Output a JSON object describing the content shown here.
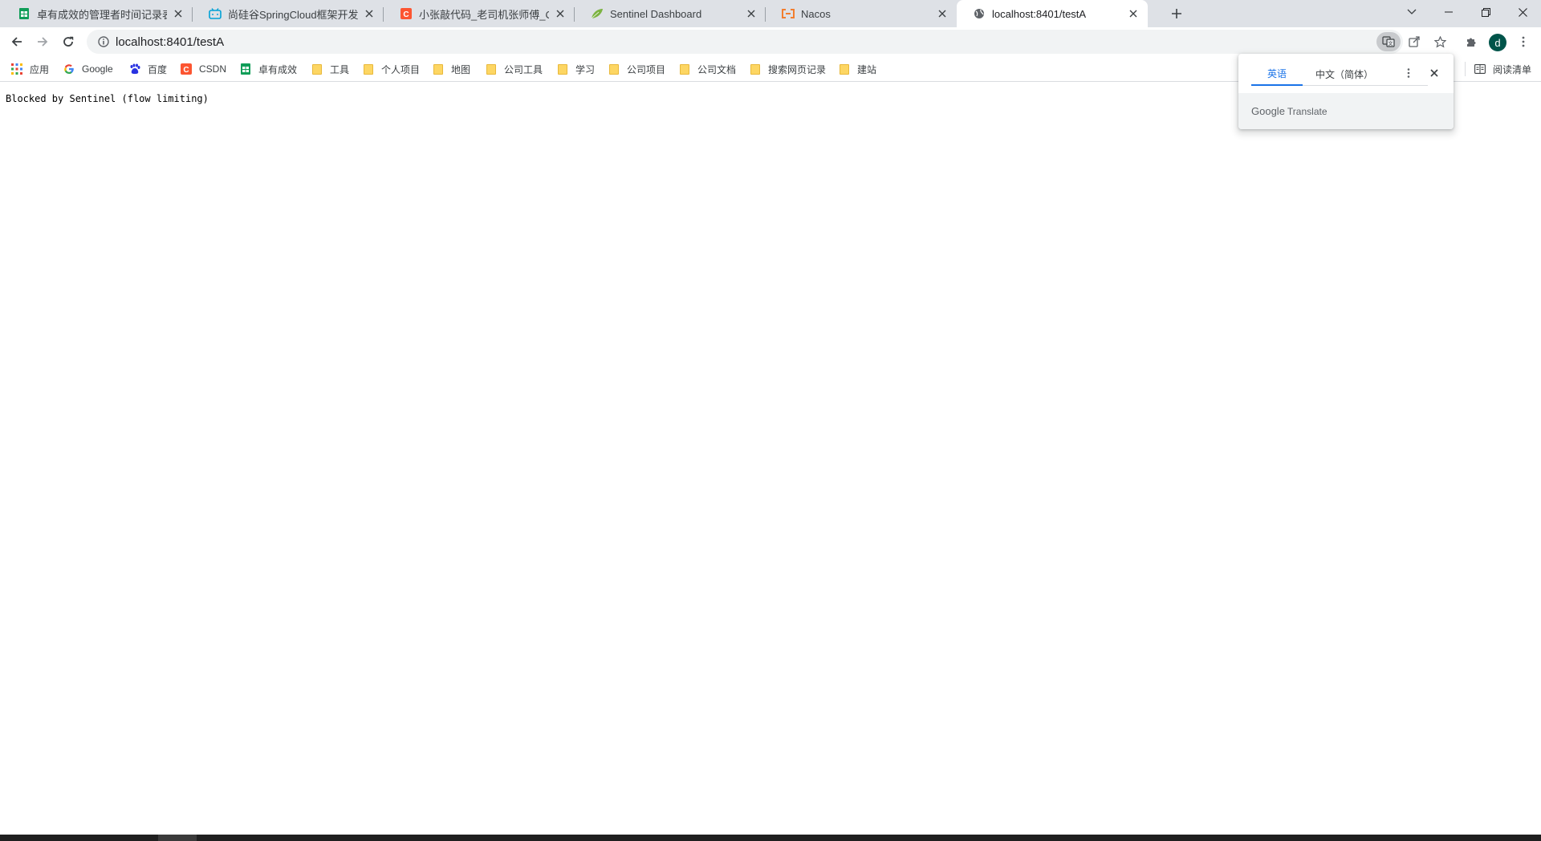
{
  "tabs": [
    {
      "title": "卓有成效的管理者时间记录表 - 金",
      "icon": "sheets-icon",
      "active": false
    },
    {
      "title": "尚硅谷SpringCloud框架开发教程",
      "icon": "bilibili-icon",
      "active": false
    },
    {
      "title": "小张敲代码_老司机张师傅_CSDN",
      "icon": "csdn-icon",
      "active": false
    },
    {
      "title": "Sentinel Dashboard",
      "icon": "sentinel-leaf-icon",
      "active": false
    },
    {
      "title": "Nacos",
      "icon": "nacos-icon",
      "active": false
    },
    {
      "title": "localhost:8401/testA",
      "icon": "globe-icon",
      "active": true
    }
  ],
  "toolbar": {
    "url": "localhost:8401/testA",
    "avatar_letter": "d"
  },
  "bookmarks": [
    {
      "label": "应用",
      "icon": "apps-grid-icon"
    },
    {
      "label": "Google",
      "icon": "google-icon"
    },
    {
      "label": "百度",
      "icon": "baidu-icon"
    },
    {
      "label": "CSDN",
      "icon": "csdn-icon"
    },
    {
      "label": "卓有成效",
      "icon": "sheets-icon"
    },
    {
      "label": "工具",
      "icon": "folder-icon"
    },
    {
      "label": "个人项目",
      "icon": "folder-icon"
    },
    {
      "label": "地图",
      "icon": "folder-icon"
    },
    {
      "label": "公司工具",
      "icon": "folder-icon"
    },
    {
      "label": "学习",
      "icon": "folder-icon"
    },
    {
      "label": "公司项目",
      "icon": "folder-icon"
    },
    {
      "label": "公司文档",
      "icon": "folder-icon"
    },
    {
      "label": "搜索网页记录",
      "icon": "folder-icon"
    },
    {
      "label": "建站",
      "icon": "folder-icon"
    }
  ],
  "reading_list": "阅读清单",
  "page": {
    "body_text": "Blocked by Sentinel (flow limiting)"
  },
  "translate_popup": {
    "source_lang": "英语",
    "target_lang": "中文（简体）",
    "footer_brand": "Google",
    "footer_product": "Translate"
  },
  "colors": {
    "tabstrip_bg": "#dee1e6",
    "accent": "#1a73e8",
    "avatar_bg": "#00544a"
  }
}
